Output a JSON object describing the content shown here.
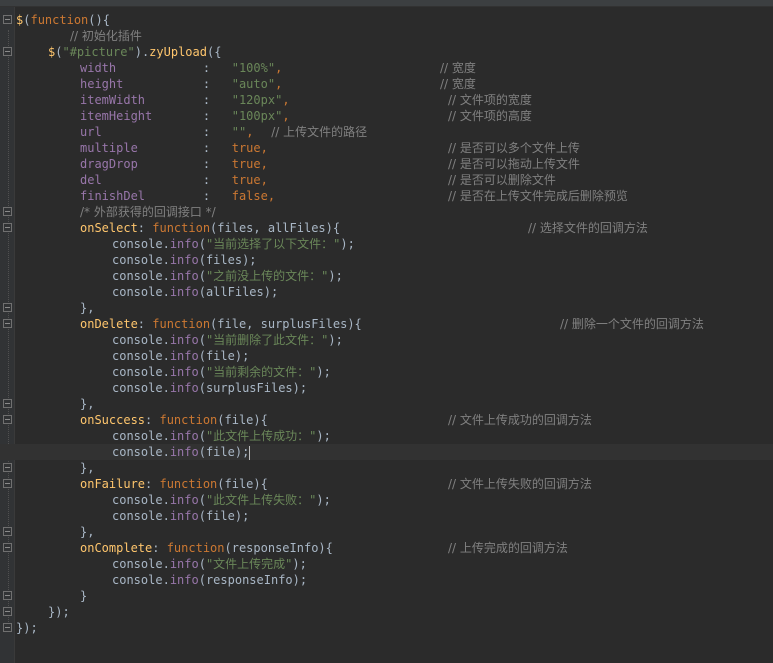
{
  "editor": {
    "theme": "darcula",
    "colors": {
      "background": "#2b2b2b",
      "gutter": "#313335",
      "keyword": "#cc7832",
      "string": "#6a8759",
      "property": "#9876aa",
      "function": "#ffc66d",
      "comment": "#808080",
      "plain": "#a9b7c6"
    },
    "lines": [
      {
        "fold": true,
        "code": [
          [
            "$",
            "fn"
          ],
          [
            "(",
            "punc"
          ],
          [
            "function",
            "kw"
          ],
          [
            "(){",
            "punc"
          ]
        ],
        "comment": ""
      },
      {
        "fold": false,
        "code": [],
        "comment": "// 初始化插件"
      },
      {
        "fold": true,
        "code": [
          [
            "$",
            "fn"
          ],
          [
            "(",
            "punc"
          ],
          [
            "\"#picture\"",
            "str"
          ],
          [
            ").",
            "punc"
          ],
          [
            "zyUpload",
            "fn"
          ],
          [
            "({",
            "punc"
          ]
        ],
        "comment": ""
      },
      {
        "fold": false,
        "code": [
          [
            "width",
            "prop"
          ],
          [
            "            :   ",
            "punc"
          ],
          [
            "\"100%\"",
            "str"
          ],
          [
            ",",
            "kw"
          ]
        ],
        "comment": "// 宽度"
      },
      {
        "fold": false,
        "code": [
          [
            "height",
            "prop"
          ],
          [
            "           :   ",
            "punc"
          ],
          [
            "\"auto\"",
            "str"
          ],
          [
            ",",
            "kw"
          ]
        ],
        "comment": "// 宽度"
      },
      {
        "fold": false,
        "code": [
          [
            "itemWidth",
            "prop"
          ],
          [
            "        :   ",
            "punc"
          ],
          [
            "\"120px\"",
            "str"
          ],
          [
            ",",
            "kw"
          ]
        ],
        "comment": "// 文件项的宽度"
      },
      {
        "fold": false,
        "code": [
          [
            "itemHeight",
            "prop"
          ],
          [
            "       :   ",
            "punc"
          ],
          [
            "\"100px\"",
            "str"
          ],
          [
            ",",
            "kw"
          ]
        ],
        "comment": "// 文件项的高度"
      },
      {
        "fold": false,
        "code": [
          [
            "url",
            "prop"
          ],
          [
            "              :   ",
            "punc"
          ],
          [
            "\"\"",
            "str"
          ],
          [
            ",",
            "kw"
          ],
          [
            "  ",
            "punc"
          ]
        ],
        "comment": "// 上传文件的路径",
        "inline": true
      },
      {
        "fold": false,
        "code": [
          [
            "multiple",
            "prop"
          ],
          [
            "         :   ",
            "punc"
          ],
          [
            "true",
            "kw"
          ],
          [
            ",",
            "kw"
          ]
        ],
        "comment": "// 是否可以多个文件上传"
      },
      {
        "fold": false,
        "code": [
          [
            "dragDrop",
            "prop"
          ],
          [
            "         :   ",
            "punc"
          ],
          [
            "true",
            "kw"
          ],
          [
            ",",
            "kw"
          ]
        ],
        "comment": "// 是否可以拖动上传文件"
      },
      {
        "fold": false,
        "code": [
          [
            "del",
            "prop"
          ],
          [
            "              :   ",
            "punc"
          ],
          [
            "true",
            "kw"
          ],
          [
            ",",
            "kw"
          ]
        ],
        "comment": "// 是否可以删除文件"
      },
      {
        "fold": false,
        "code": [
          [
            "finishDel",
            "prop"
          ],
          [
            "        :   ",
            "punc"
          ],
          [
            "false",
            "kw"
          ],
          [
            ",",
            "kw"
          ]
        ],
        "comment": "// 是否在上传文件完成后删除预览"
      },
      {
        "fold": true,
        "code": [],
        "comment": "/* 外部获得的回调接口 */"
      },
      {
        "fold": true,
        "code": [
          [
            "onSelect",
            "fn"
          ],
          [
            ": ",
            "punc"
          ],
          [
            "function",
            "kw"
          ],
          [
            "(files, allFiles){",
            "punc"
          ]
        ],
        "comment": "// 选择文件的回调方法"
      },
      {
        "fold": false,
        "code": [
          [
            "console",
            "id"
          ],
          [
            ".",
            "punc"
          ],
          [
            "info",
            "prop"
          ],
          [
            "(",
            "punc"
          ],
          [
            "\"当前选择了以下文件：\"",
            "str"
          ],
          [
            ");",
            "punc"
          ]
        ],
        "comment": ""
      },
      {
        "fold": false,
        "code": [
          [
            "console",
            "id"
          ],
          [
            ".",
            "punc"
          ],
          [
            "info",
            "prop"
          ],
          [
            "(files);",
            "punc"
          ]
        ],
        "comment": ""
      },
      {
        "fold": false,
        "code": [
          [
            "console",
            "id"
          ],
          [
            ".",
            "punc"
          ],
          [
            "info",
            "prop"
          ],
          [
            "(",
            "punc"
          ],
          [
            "\"之前没上传的文件：\"",
            "str"
          ],
          [
            ");",
            "punc"
          ]
        ],
        "comment": ""
      },
      {
        "fold": false,
        "code": [
          [
            "console",
            "id"
          ],
          [
            ".",
            "punc"
          ],
          [
            "info",
            "prop"
          ],
          [
            "(allFiles);",
            "punc"
          ]
        ],
        "comment": ""
      },
      {
        "fold": true,
        "code": [
          [
            "},",
            "punc"
          ]
        ],
        "comment": ""
      },
      {
        "fold": true,
        "code": [
          [
            "onDelete",
            "fn"
          ],
          [
            ": ",
            "punc"
          ],
          [
            "function",
            "kw"
          ],
          [
            "(file, surplusFiles){",
            "punc"
          ]
        ],
        "comment": "// 删除一个文件的回调方法"
      },
      {
        "fold": false,
        "code": [
          [
            "console",
            "id"
          ],
          [
            ".",
            "punc"
          ],
          [
            "info",
            "prop"
          ],
          [
            "(",
            "punc"
          ],
          [
            "\"当前删除了此文件：\"",
            "str"
          ],
          [
            ");",
            "punc"
          ]
        ],
        "comment": ""
      },
      {
        "fold": false,
        "code": [
          [
            "console",
            "id"
          ],
          [
            ".",
            "punc"
          ],
          [
            "info",
            "prop"
          ],
          [
            "(file);",
            "punc"
          ]
        ],
        "comment": ""
      },
      {
        "fold": false,
        "code": [
          [
            "console",
            "id"
          ],
          [
            ".",
            "punc"
          ],
          [
            "info",
            "prop"
          ],
          [
            "(",
            "punc"
          ],
          [
            "\"当前剩余的文件：\"",
            "str"
          ],
          [
            ");",
            "punc"
          ]
        ],
        "comment": ""
      },
      {
        "fold": false,
        "code": [
          [
            "console",
            "id"
          ],
          [
            ".",
            "punc"
          ],
          [
            "info",
            "prop"
          ],
          [
            "(surplusFiles);",
            "punc"
          ]
        ],
        "comment": ""
      },
      {
        "fold": true,
        "code": [
          [
            "},",
            "punc"
          ]
        ],
        "comment": ""
      },
      {
        "fold": true,
        "code": [
          [
            "onSuccess",
            "fn"
          ],
          [
            ": ",
            "punc"
          ],
          [
            "function",
            "kw"
          ],
          [
            "(file){",
            "punc"
          ]
        ],
        "comment": "// 文件上传成功的回调方法"
      },
      {
        "fold": false,
        "code": [
          [
            "console",
            "id"
          ],
          [
            ".",
            "punc"
          ],
          [
            "info",
            "prop"
          ],
          [
            "(",
            "punc"
          ],
          [
            "\"此文件上传成功：\"",
            "str"
          ],
          [
            ");",
            "punc"
          ]
        ],
        "comment": ""
      },
      {
        "fold": false,
        "code": [
          [
            "console",
            "id"
          ],
          [
            ".",
            "punc"
          ],
          [
            "info",
            "prop"
          ],
          [
            "(file);",
            "punc"
          ]
        ],
        "comment": "",
        "highlight": true
      },
      {
        "fold": true,
        "code": [
          [
            "},",
            "punc"
          ]
        ],
        "comment": ""
      },
      {
        "fold": true,
        "code": [
          [
            "onFailure",
            "fn"
          ],
          [
            ": ",
            "punc"
          ],
          [
            "function",
            "kw"
          ],
          [
            "(file){",
            "punc"
          ]
        ],
        "comment": "// 文件上传失败的回调方法"
      },
      {
        "fold": false,
        "code": [
          [
            "console",
            "id"
          ],
          [
            ".",
            "punc"
          ],
          [
            "info",
            "prop"
          ],
          [
            "(",
            "punc"
          ],
          [
            "\"此文件上传失败：\"",
            "str"
          ],
          [
            ");",
            "punc"
          ]
        ],
        "comment": ""
      },
      {
        "fold": false,
        "code": [
          [
            "console",
            "id"
          ],
          [
            ".",
            "punc"
          ],
          [
            "info",
            "prop"
          ],
          [
            "(file);",
            "punc"
          ]
        ],
        "comment": ""
      },
      {
        "fold": true,
        "code": [
          [
            "},",
            "punc"
          ]
        ],
        "comment": ""
      },
      {
        "fold": true,
        "code": [
          [
            "onComplete",
            "fn"
          ],
          [
            ": ",
            "punc"
          ],
          [
            "function",
            "kw"
          ],
          [
            "(responseInfo){",
            "punc"
          ]
        ],
        "comment": "// 上传完成的回调方法"
      },
      {
        "fold": false,
        "code": [
          [
            "console",
            "id"
          ],
          [
            ".",
            "punc"
          ],
          [
            "info",
            "prop"
          ],
          [
            "(",
            "punc"
          ],
          [
            "\"文件上传完成\"",
            "str"
          ],
          [
            ");",
            "punc"
          ]
        ],
        "comment": ""
      },
      {
        "fold": false,
        "code": [
          [
            "console",
            "id"
          ],
          [
            ".",
            "punc"
          ],
          [
            "info",
            "prop"
          ],
          [
            "(responseInfo);",
            "punc"
          ]
        ],
        "comment": ""
      },
      {
        "fold": true,
        "code": [
          [
            "}",
            "punc"
          ]
        ],
        "comment": ""
      },
      {
        "fold": true,
        "code": [
          [
            "});",
            "punc"
          ]
        ],
        "comment": ""
      },
      {
        "fold": true,
        "code": [
          [
            "});",
            "punc"
          ]
        ],
        "comment": ""
      }
    ]
  }
}
